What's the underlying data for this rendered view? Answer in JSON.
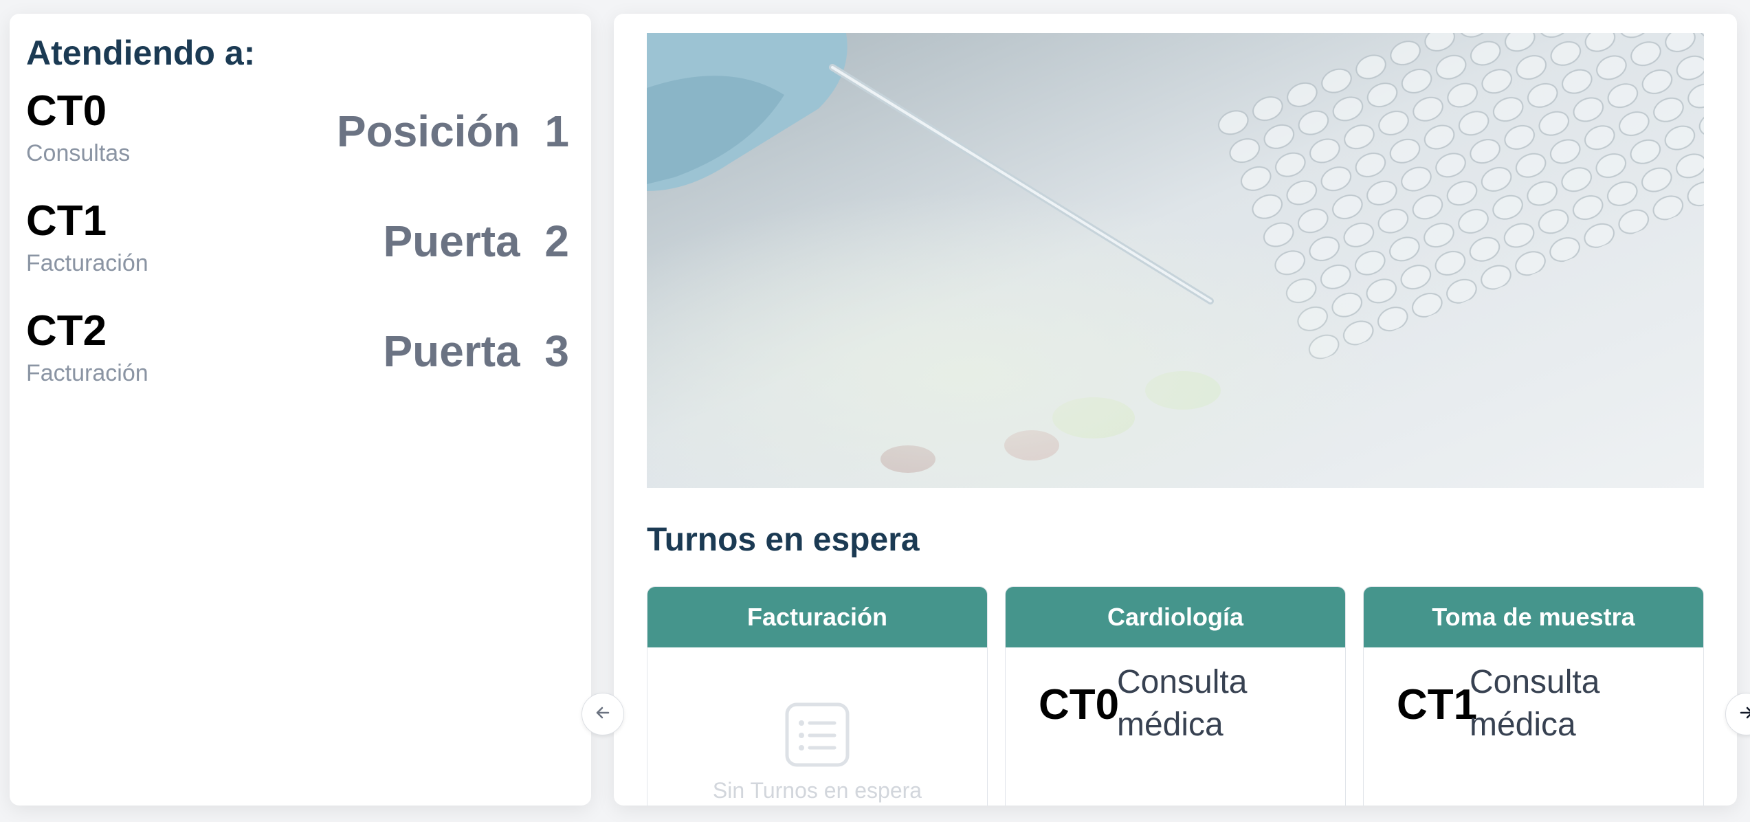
{
  "serving": {
    "title": "Atendiendo a:",
    "entries": [
      {
        "ticket": "CT0",
        "service": "Consultas",
        "location": "Posición 1"
      },
      {
        "ticket": "CT1",
        "service": "Facturación",
        "location": "Puerta 2"
      },
      {
        "ticket": "CT2",
        "service": "Facturación",
        "location": "Puerta 3"
      }
    ]
  },
  "media": {
    "icon": "laboratory-pipette-photo"
  },
  "queue": {
    "title": "Turnos en espera",
    "columns": [
      {
        "header": "Facturación",
        "empty_text": "Sin Turnos en espera"
      },
      {
        "header": "Cardiología",
        "entries": [
          {
            "ticket": "CT0",
            "service": "Consulta médica"
          }
        ]
      },
      {
        "header": "Toma de muestra",
        "entries": [
          {
            "ticket": "CT1",
            "service": "Consulta médica"
          }
        ]
      }
    ]
  },
  "nav": {
    "prev_icon": "arrow-left-icon",
    "next_icon": "arrow-right-icon"
  },
  "colors": {
    "header_teal": "#45958c",
    "title_navy": "#1b3a53",
    "location_gray": "#6b7383"
  }
}
